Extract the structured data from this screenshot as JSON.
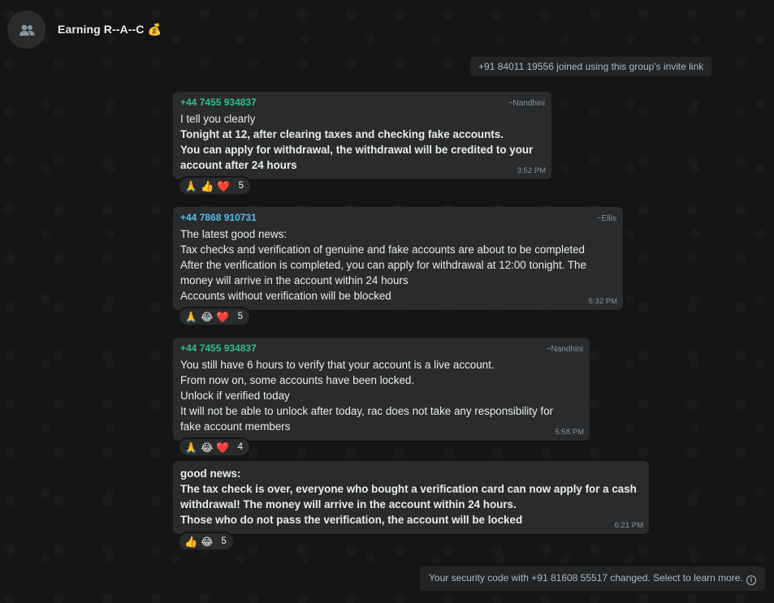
{
  "header": {
    "title": "Earning R--A--C 💰"
  },
  "system": {
    "joined": "+91 84011 19556 joined using this group's invite link",
    "security": "Your security code with +91 81608 55517 changed. Select to learn more."
  },
  "messages": [
    {
      "sender": "+44 7455 934837",
      "sender_color": "#2fbf8e",
      "alias": "~Nandhini",
      "lines": [
        {
          "text": "I tell you clearly",
          "bold": false
        },
        {
          "text": "Tonight at 12, after clearing taxes and checking fake accounts.",
          "bold": true
        },
        {
          "text": "You can apply for withdrawal, the withdrawal will be credited to your",
          "bold": true
        },
        {
          "text": "account after 24 hours",
          "bold": true
        }
      ],
      "time": "3:52 PM",
      "reactions": {
        "emojis": [
          "🙏",
          "👍",
          "❤️"
        ],
        "count": "5"
      }
    },
    {
      "sender": "+44 7868 910731",
      "sender_color": "#53bdeb",
      "alias": "~Ellis",
      "lines": [
        {
          "text": "The latest good news:",
          "bold": false
        },
        {
          "text": "Tax checks and verification of genuine and fake accounts are about to be completed",
          "bold": false
        },
        {
          "text": "After the verification is completed, you can apply for withdrawal at 12:00 tonight. The",
          "bold": false
        },
        {
          "text": "money will arrive in the account within 24 hours",
          "bold": false
        },
        {
          "text": "Accounts without verification will be blocked",
          "bold": false
        }
      ],
      "time": "5:32 PM",
      "reactions": {
        "emojis": [
          "🙏",
          "😂",
          "❤️"
        ],
        "count": "5"
      }
    },
    {
      "sender": "+44 7455 934837",
      "sender_color": "#2fbf8e",
      "alias": "~Nandhini",
      "lines": [
        {
          "text": "You still have 6 hours to verify that your account is a live account.",
          "bold": false
        },
        {
          "text": "From now on, some accounts have been locked.",
          "bold": false
        },
        {
          "text": "Unlock if verified today",
          "bold": false
        },
        {
          "text": "It will not be able to unlock after today, rac does not take any responsibility for",
          "bold": false
        },
        {
          "text": "fake account members",
          "bold": false
        }
      ],
      "time": "5:58 PM",
      "reactions": {
        "emojis": [
          "🙏",
          "😂",
          "❤️"
        ],
        "count": "4"
      }
    },
    {
      "sender": "",
      "alias": "",
      "lines": [
        {
          "text": "good news:",
          "bold": true
        },
        {
          "text": "The tax check is over, everyone who bought a verification card can now apply for a cash",
          "bold": true
        },
        {
          "text": "withdrawal! The money will arrive in the account within 24 hours.",
          "bold": true
        },
        {
          "text": "Those who do not pass the verification, the account will be locked",
          "bold": true
        }
      ],
      "time": "6:21 PM",
      "reactions": {
        "emojis": [
          "👍",
          "😂"
        ],
        "count": "5"
      }
    }
  ]
}
